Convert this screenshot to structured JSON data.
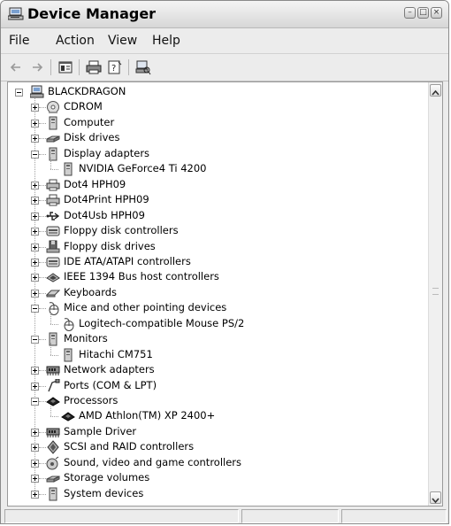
{
  "window": {
    "title": "Device Manager"
  },
  "menu": [
    "File",
    "Action",
    "View",
    "Help"
  ],
  "toolbar": [
    "back",
    "forward",
    "properties",
    "print",
    "help",
    "scan-hardware"
  ],
  "tree": {
    "root": "BLACKDRAGON",
    "items": [
      {
        "label": "CDROM",
        "icon": "cdrom-icon",
        "state": "collapsed"
      },
      {
        "label": "Computer",
        "icon": "computer-icon",
        "state": "collapsed"
      },
      {
        "label": "Disk drives",
        "icon": "disk-drive-icon",
        "state": "collapsed"
      },
      {
        "label": "Display adapters",
        "icon": "display-adapter-icon",
        "state": "expanded",
        "children": [
          "NVIDIA GeForce4 Ti 4200"
        ]
      },
      {
        "label": "Dot4 HPH09",
        "icon": "printer-icon",
        "state": "collapsed"
      },
      {
        "label": "Dot4Print HPH09",
        "icon": "printer-icon",
        "state": "collapsed"
      },
      {
        "label": "Dot4Usb HPH09",
        "icon": "usb-icon",
        "state": "collapsed"
      },
      {
        "label": "Floppy disk controllers",
        "icon": "floppy-controller-icon",
        "state": "collapsed"
      },
      {
        "label": "Floppy disk drives",
        "icon": "floppy-drive-icon",
        "state": "collapsed"
      },
      {
        "label": "IDE ATA/ATAPI controllers",
        "icon": "ide-controller-icon",
        "state": "collapsed"
      },
      {
        "label": "IEEE 1394 Bus host controllers",
        "icon": "firewire-icon",
        "state": "collapsed"
      },
      {
        "label": "Keyboards",
        "icon": "keyboard-icon",
        "state": "collapsed"
      },
      {
        "label": "Mice and other pointing devices",
        "icon": "mouse-icon",
        "state": "expanded",
        "children": [
          "Logitech-compatible Mouse PS/2"
        ]
      },
      {
        "label": "Monitors",
        "icon": "monitor-icon",
        "state": "expanded",
        "children": [
          "Hitachi CM751"
        ]
      },
      {
        "label": "Network adapters",
        "icon": "network-adapter-icon",
        "state": "collapsed"
      },
      {
        "label": "Ports (COM & LPT)",
        "icon": "port-icon",
        "state": "collapsed"
      },
      {
        "label": "Processors",
        "icon": "processor-icon",
        "state": "expanded",
        "children": [
          "AMD Athlon(TM) XP 2400+"
        ]
      },
      {
        "label": "Sample Driver",
        "icon": "network-adapter-icon",
        "state": "collapsed"
      },
      {
        "label": "SCSI and RAID controllers",
        "icon": "scsi-icon",
        "state": "collapsed"
      },
      {
        "label": "Sound, video and game controllers",
        "icon": "sound-icon",
        "state": "collapsed"
      },
      {
        "label": "Storage volumes",
        "icon": "disk-drive-icon",
        "state": "collapsed"
      },
      {
        "label": "System devices",
        "icon": "computer-icon",
        "state": "collapsed"
      }
    ]
  }
}
